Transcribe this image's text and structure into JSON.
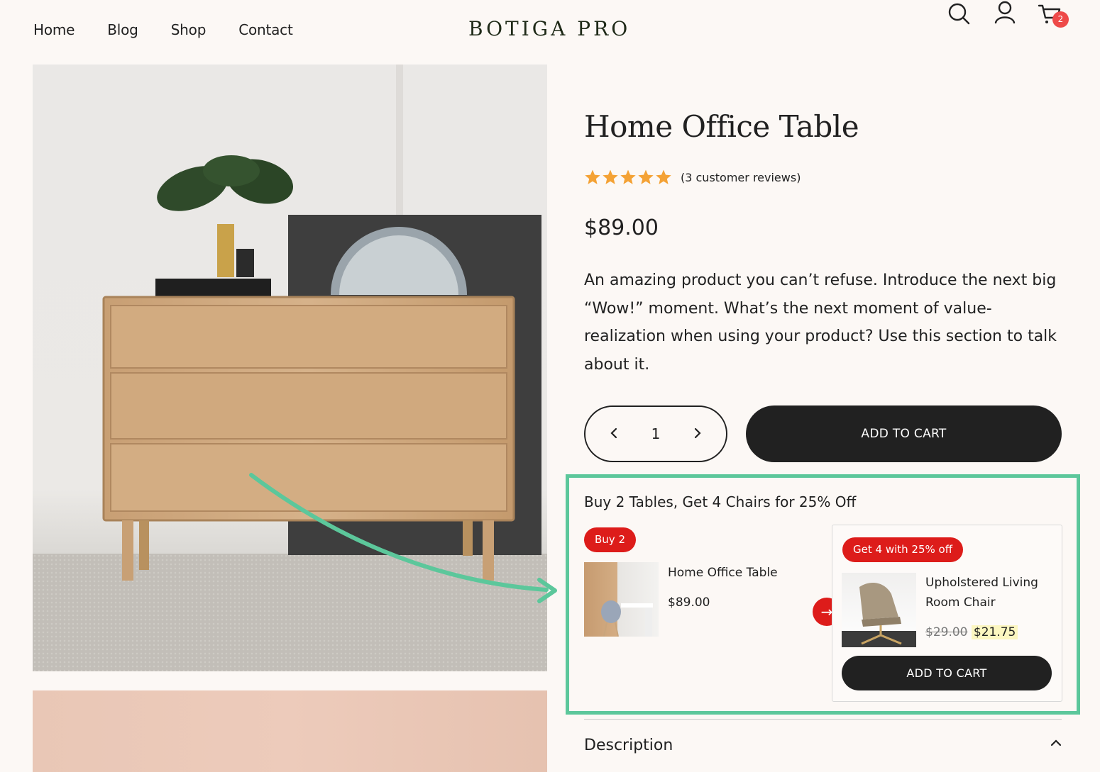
{
  "nav": {
    "items": [
      "Home",
      "Blog",
      "Shop",
      "Contact"
    ]
  },
  "brand": {
    "logo": "BOTIGA PRO"
  },
  "header_icons": {
    "search": "search-icon",
    "account": "user-icon",
    "cart": "cart-icon",
    "cart_count": "2"
  },
  "product": {
    "title": "Home Office Table",
    "rating_stars": 5,
    "reviews_text": "(3 customer reviews)",
    "price": "$89.00",
    "description": "An amazing product you can’t refuse. Introduce the next big “Wow!” moment. What’s the next moment of value-realization when using your product? Use this section to talk about it.",
    "quantity": "1",
    "add_to_cart": "ADD TO CART"
  },
  "bundle": {
    "title": "Buy 2 Tables, Get 4 Chairs for 25% Off",
    "buy_badge": "Buy 2",
    "buy_product_name": "Home Office Table",
    "buy_product_price": "$89.00",
    "get_badge": "Get 4 with 25% off",
    "get_product_name": "Upholstered Living Room Chair",
    "get_old_price": "$29.00",
    "get_new_price": "$21.75",
    "add_to_cart": "ADD TO CART"
  },
  "accordion": {
    "description_title": "Description"
  },
  "colors": {
    "background": "#fcf8f5",
    "dark": "#212121",
    "accent_red": "#dd1c1a",
    "highlight_green": "#5cc79b",
    "badge_red": "#ee4a49"
  }
}
